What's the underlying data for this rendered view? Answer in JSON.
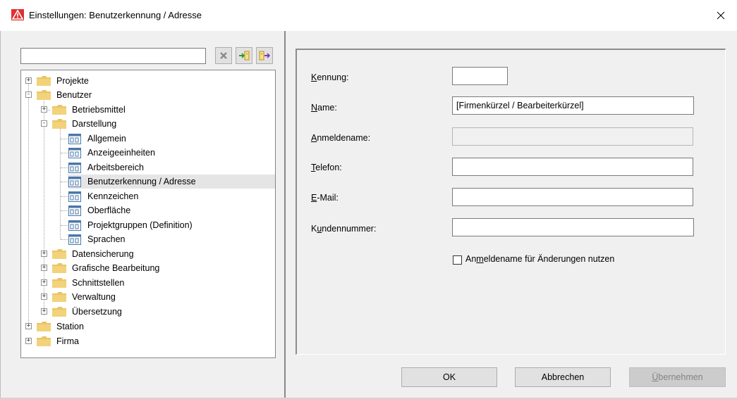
{
  "window": {
    "title": "Einstellungen: Benutzerkennung / Adresse",
    "accent_color": "#e03030"
  },
  "sidebar": {
    "search": {
      "value": "",
      "placeholder": ""
    },
    "toolbar": [
      {
        "icon": "clear-icon"
      },
      {
        "icon": "expand-all-icon"
      },
      {
        "icon": "collapse-all-icon"
      }
    ],
    "tree": [
      {
        "label": "Projekte",
        "level": 0,
        "type": "folder",
        "expander": "+"
      },
      {
        "label": "Benutzer",
        "level": 0,
        "type": "folder",
        "expander": "-"
      },
      {
        "label": "Betriebsmittel",
        "level": 1,
        "type": "folder",
        "expander": "+"
      },
      {
        "label": "Darstellung",
        "level": 1,
        "type": "folder",
        "expander": "-"
      },
      {
        "label": "Allgemein",
        "level": 2,
        "type": "page"
      },
      {
        "label": "Anzeigeeinheiten",
        "level": 2,
        "type": "page"
      },
      {
        "label": "Arbeitsbereich",
        "level": 2,
        "type": "page"
      },
      {
        "label": "Benutzerkennung / Adresse",
        "level": 2,
        "type": "page",
        "selected": true
      },
      {
        "label": "Kennzeichen",
        "level": 2,
        "type": "page"
      },
      {
        "label": "Oberfläche",
        "level": 2,
        "type": "page"
      },
      {
        "label": "Projektgruppen (Definition)",
        "level": 2,
        "type": "page"
      },
      {
        "label": "Sprachen",
        "level": 2,
        "type": "page"
      },
      {
        "label": "Datensicherung",
        "level": 1,
        "type": "folder",
        "expander": "+"
      },
      {
        "label": "Grafische Bearbeitung",
        "level": 1,
        "type": "folder",
        "expander": "+"
      },
      {
        "label": "Schnittstellen",
        "level": 1,
        "type": "folder",
        "expander": "+"
      },
      {
        "label": "Verwaltung",
        "level": 1,
        "type": "folder",
        "expander": "+"
      },
      {
        "label": "Übersetzung",
        "level": 1,
        "type": "folder",
        "expander": "+"
      },
      {
        "label": "Station",
        "level": 0,
        "type": "folder",
        "expander": "+"
      },
      {
        "label": "Firma",
        "level": 0,
        "type": "folder",
        "expander": "+"
      }
    ]
  },
  "form": {
    "fields": [
      {
        "label": "Kennung:",
        "mnemonic": "K",
        "rest": "ennung:",
        "value": "",
        "disabled": false
      },
      {
        "label": "Name:",
        "mnemonic": "N",
        "rest": "ame:",
        "value": "[Firmenkürzel / Bearbeiterkürzel]",
        "disabled": false
      },
      {
        "label": "Anmeldename:",
        "mnemonic": "A",
        "rest": "nmeldename:",
        "value": "",
        "disabled": true
      },
      {
        "label": "Telefon:",
        "mnemonic": "T",
        "rest": "elefon:",
        "value": "",
        "disabled": false
      },
      {
        "label": "E-Mail:",
        "mnemonic": "E",
        "rest": "-Mail:",
        "value": "",
        "disabled": false
      },
      {
        "label": "Kundennummer:",
        "pre": "K",
        "mnemonic": "u",
        "rest": "ndennummer:",
        "value": "",
        "disabled": false
      }
    ],
    "checkbox": {
      "pre": "An",
      "mnemonic": "m",
      "rest": "eldename für Änderungen nutzen",
      "checked": false
    }
  },
  "buttons": {
    "ok": "OK",
    "cancel": "Abbrechen",
    "apply_mnemonic": "Ü",
    "apply_rest": "bernehmen"
  }
}
